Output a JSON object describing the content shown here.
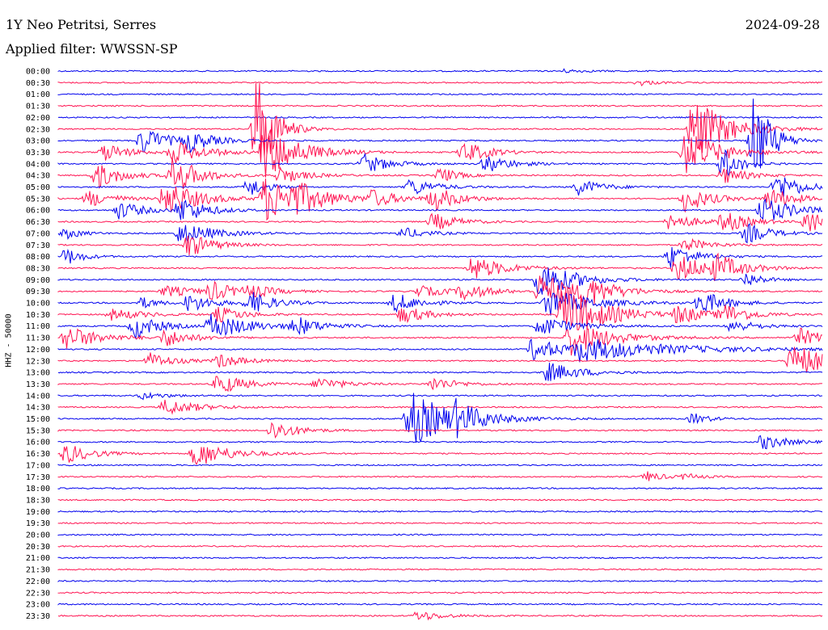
{
  "header": {
    "station": "1Y Neo Petritsi, Serres",
    "date": "2024-09-28",
    "filter": "Applied filter: WWSSN-SP",
    "channel": "HHZ - 50000"
  },
  "colors": {
    "even_row": "#0000ee",
    "odd_row": "#ff1452",
    "background": "#ffffff"
  },
  "chart_data": {
    "type": "line",
    "title": "1Y Neo Petritsi, Serres",
    "subtitle": "Applied filter: WWSSN-SP",
    "ylabel": "HHZ - 50000",
    "xlabel": "",
    "legend": "none",
    "grid": false,
    "rows": [
      "00:00",
      "00:30",
      "01:00",
      "01:30",
      "02:00",
      "02:30",
      "03:00",
      "03:30",
      "04:00",
      "04:30",
      "05:00",
      "05:30",
      "06:00",
      "06:30",
      "07:00",
      "07:30",
      "08:00",
      "08:30",
      "09:00",
      "09:30",
      "10:00",
      "10:30",
      "11:00",
      "11:30",
      "12:00",
      "12:30",
      "13:00",
      "13:30",
      "14:00",
      "14:30",
      "15:00",
      "15:30",
      "16:00",
      "16:30",
      "17:00",
      "17:30",
      "18:00",
      "18:30",
      "19:00",
      "19:30",
      "20:00",
      "20:30",
      "21:00",
      "21:30",
      "22:00",
      "22:30",
      "23:00",
      "23:30"
    ],
    "row_minutes": 30,
    "events": [
      {
        "row": 0,
        "t": 0.66,
        "amp": 0.3,
        "dur": 0.03
      },
      {
        "row": 1,
        "t": 0.76,
        "amp": 0.5,
        "dur": 0.02
      },
      {
        "row": 5,
        "t": 0.83,
        "amp": 6.0,
        "dur": 0.04
      },
      {
        "row": 5,
        "t": 0.26,
        "amp": 11.0,
        "dur": 0.02
      },
      {
        "row": 6,
        "t": 0.11,
        "amp": 2.5,
        "dur": 0.03
      },
      {
        "row": 6,
        "t": 0.17,
        "amp": 1.8,
        "dur": 0.03
      },
      {
        "row": 6,
        "t": 0.91,
        "amp": 9.0,
        "dur": 0.02
      },
      {
        "row": 7,
        "t": 0.06,
        "amp": 1.6,
        "dur": 0.03
      },
      {
        "row": 7,
        "t": 0.15,
        "amp": 2.0,
        "dur": 0.04
      },
      {
        "row": 7,
        "t": 0.27,
        "amp": 5.0,
        "dur": 0.04
      },
      {
        "row": 7,
        "t": 0.53,
        "amp": 2.0,
        "dur": 0.03
      },
      {
        "row": 7,
        "t": 0.82,
        "amp": 4.0,
        "dur": 0.04
      },
      {
        "row": 8,
        "t": 0.4,
        "amp": 1.8,
        "dur": 0.03
      },
      {
        "row": 8,
        "t": 0.56,
        "amp": 1.6,
        "dur": 0.03
      },
      {
        "row": 8,
        "t": 0.87,
        "amp": 3.0,
        "dur": 0.02
      },
      {
        "row": 9,
        "t": 0.05,
        "amp": 2.4,
        "dur": 0.03
      },
      {
        "row": 9,
        "t": 0.15,
        "amp": 3.6,
        "dur": 0.03
      },
      {
        "row": 9,
        "t": 0.29,
        "amp": 1.5,
        "dur": 0.03
      },
      {
        "row": 9,
        "t": 0.5,
        "amp": 1.5,
        "dur": 0.02
      },
      {
        "row": 9,
        "t": 0.87,
        "amp": 1.4,
        "dur": 0.03
      },
      {
        "row": 10,
        "t": 0.25,
        "amp": 1.8,
        "dur": 0.02
      },
      {
        "row": 10,
        "t": 0.46,
        "amp": 1.6,
        "dur": 0.03
      },
      {
        "row": 10,
        "t": 0.68,
        "amp": 1.4,
        "dur": 0.03
      },
      {
        "row": 10,
        "t": 0.94,
        "amp": 2.6,
        "dur": 0.03
      },
      {
        "row": 11,
        "t": 0.04,
        "amp": 1.5,
        "dur": 0.03
      },
      {
        "row": 11,
        "t": 0.14,
        "amp": 3.2,
        "dur": 0.04
      },
      {
        "row": 11,
        "t": 0.27,
        "amp": 4.0,
        "dur": 0.05
      },
      {
        "row": 11,
        "t": 0.31,
        "amp": 1.6,
        "dur": 0.03
      },
      {
        "row": 11,
        "t": 0.41,
        "amp": 1.4,
        "dur": 0.03
      },
      {
        "row": 11,
        "t": 0.49,
        "amp": 2.2,
        "dur": 0.03
      },
      {
        "row": 11,
        "t": 0.82,
        "amp": 2.4,
        "dur": 0.03
      },
      {
        "row": 11,
        "t": 0.93,
        "amp": 2.0,
        "dur": 0.03
      },
      {
        "row": 12,
        "t": 0.08,
        "amp": 1.6,
        "dur": 0.03
      },
      {
        "row": 12,
        "t": 0.16,
        "amp": 2.4,
        "dur": 0.03
      },
      {
        "row": 12,
        "t": 0.92,
        "amp": 2.4,
        "dur": 0.04
      },
      {
        "row": 13,
        "t": 0.49,
        "amp": 1.6,
        "dur": 0.03
      },
      {
        "row": 13,
        "t": 0.8,
        "amp": 1.6,
        "dur": 0.03
      },
      {
        "row": 13,
        "t": 0.87,
        "amp": 1.8,
        "dur": 0.03
      },
      {
        "row": 13,
        "t": 0.98,
        "amp": 2.4,
        "dur": 0.02
      },
      {
        "row": 14,
        "t": 0.01,
        "amp": 1.0,
        "dur": 0.02
      },
      {
        "row": 14,
        "t": 0.16,
        "amp": 2.0,
        "dur": 0.04
      },
      {
        "row": 14,
        "t": 0.45,
        "amp": 1.0,
        "dur": 0.03
      },
      {
        "row": 14,
        "t": 0.9,
        "amp": 1.8,
        "dur": 0.03
      },
      {
        "row": 15,
        "t": 0.17,
        "amp": 2.2,
        "dur": 0.03
      },
      {
        "row": 15,
        "t": 0.82,
        "amp": 1.2,
        "dur": 0.03
      },
      {
        "row": 16,
        "t": 0.01,
        "amp": 1.6,
        "dur": 0.02
      },
      {
        "row": 16,
        "t": 0.8,
        "amp": 2.2,
        "dur": 0.03
      },
      {
        "row": 17,
        "t": 0.54,
        "amp": 2.2,
        "dur": 0.04
      },
      {
        "row": 17,
        "t": 0.81,
        "amp": 2.4,
        "dur": 0.04
      },
      {
        "row": 17,
        "t": 0.86,
        "amp": 2.0,
        "dur": 0.03
      },
      {
        "row": 18,
        "t": 0.63,
        "amp": 3.6,
        "dur": 0.04
      },
      {
        "row": 18,
        "t": 0.9,
        "amp": 1.4,
        "dur": 0.02
      },
      {
        "row": 19,
        "t": 0.14,
        "amp": 1.0,
        "dur": 0.04
      },
      {
        "row": 19,
        "t": 0.2,
        "amp": 1.6,
        "dur": 0.03
      },
      {
        "row": 19,
        "t": 0.25,
        "amp": 1.0,
        "dur": 0.03
      },
      {
        "row": 19,
        "t": 0.47,
        "amp": 1.0,
        "dur": 0.04
      },
      {
        "row": 19,
        "t": 0.53,
        "amp": 1.4,
        "dur": 0.03
      },
      {
        "row": 19,
        "t": 0.63,
        "amp": 3.0,
        "dur": 0.05
      },
      {
        "row": 19,
        "t": 0.69,
        "amp": 2.2,
        "dur": 0.03
      },
      {
        "row": 20,
        "t": 0.11,
        "amp": 1.0,
        "dur": 0.02
      },
      {
        "row": 20,
        "t": 0.17,
        "amp": 1.6,
        "dur": 0.03
      },
      {
        "row": 20,
        "t": 0.25,
        "amp": 2.0,
        "dur": 0.03
      },
      {
        "row": 20,
        "t": 0.44,
        "amp": 1.8,
        "dur": 0.03
      },
      {
        "row": 20,
        "t": 0.64,
        "amp": 2.6,
        "dur": 0.05
      },
      {
        "row": 20,
        "t": 0.84,
        "amp": 2.2,
        "dur": 0.03
      },
      {
        "row": 21,
        "t": 0.07,
        "amp": 1.0,
        "dur": 0.04
      },
      {
        "row": 21,
        "t": 0.21,
        "amp": 1.4,
        "dur": 0.03
      },
      {
        "row": 21,
        "t": 0.45,
        "amp": 1.6,
        "dur": 0.03
      },
      {
        "row": 21,
        "t": 0.66,
        "amp": 5.0,
        "dur": 0.05
      },
      {
        "row": 21,
        "t": 0.81,
        "amp": 1.6,
        "dur": 0.03
      },
      {
        "row": 21,
        "t": 0.87,
        "amp": 1.8,
        "dur": 0.03
      },
      {
        "row": 22,
        "t": 0.1,
        "amp": 2.2,
        "dur": 0.03
      },
      {
        "row": 22,
        "t": 0.2,
        "amp": 2.2,
        "dur": 0.05
      },
      {
        "row": 22,
        "t": 0.31,
        "amp": 1.6,
        "dur": 0.03
      },
      {
        "row": 22,
        "t": 0.63,
        "amp": 1.8,
        "dur": 0.04
      },
      {
        "row": 22,
        "t": 0.88,
        "amp": 1.2,
        "dur": 0.03
      },
      {
        "row": 23,
        "t": 0.01,
        "amp": 2.2,
        "dur": 0.04
      },
      {
        "row": 23,
        "t": 0.14,
        "amp": 1.6,
        "dur": 0.03
      },
      {
        "row": 23,
        "t": 0.67,
        "amp": 3.0,
        "dur": 0.05
      },
      {
        "row": 23,
        "t": 0.97,
        "amp": 1.6,
        "dur": 0.03
      },
      {
        "row": 24,
        "t": 0.62,
        "amp": 2.0,
        "dur": 0.04
      },
      {
        "row": 24,
        "t": 0.68,
        "amp": 1.8,
        "dur": 0.12
      },
      {
        "row": 25,
        "t": 0.12,
        "amp": 1.4,
        "dur": 0.03
      },
      {
        "row": 25,
        "t": 0.21,
        "amp": 1.2,
        "dur": 0.03
      },
      {
        "row": 25,
        "t": 0.96,
        "amp": 2.8,
        "dur": 0.06
      },
      {
        "row": 26,
        "t": 0.64,
        "amp": 1.8,
        "dur": 0.04
      },
      {
        "row": 27,
        "t": 0.21,
        "amp": 2.0,
        "dur": 0.03
      },
      {
        "row": 27,
        "t": 0.34,
        "amp": 1.2,
        "dur": 0.03
      },
      {
        "row": 27,
        "t": 0.49,
        "amp": 1.2,
        "dur": 0.03
      },
      {
        "row": 28,
        "t": 0.11,
        "amp": 0.6,
        "dur": 0.03
      },
      {
        "row": 29,
        "t": 0.14,
        "amp": 1.4,
        "dur": 0.04
      },
      {
        "row": 30,
        "t": 0.46,
        "amp": 5.0,
        "dur": 0.05
      },
      {
        "row": 30,
        "t": 0.52,
        "amp": 2.0,
        "dur": 0.03
      },
      {
        "row": 30,
        "t": 0.83,
        "amp": 1.0,
        "dur": 0.02
      },
      {
        "row": 31,
        "t": 0.28,
        "amp": 1.8,
        "dur": 0.03
      },
      {
        "row": 32,
        "t": 0.92,
        "amp": 1.4,
        "dur": 0.03
      },
      {
        "row": 33,
        "t": 0.01,
        "amp": 1.8,
        "dur": 0.03
      },
      {
        "row": 33,
        "t": 0.18,
        "amp": 2.4,
        "dur": 0.04
      },
      {
        "row": 35,
        "t": 0.77,
        "amp": 0.9,
        "dur": 0.02
      },
      {
        "row": 35,
        "t": 0.82,
        "amp": 0.5,
        "dur": 0.02
      },
      {
        "row": 47,
        "t": 0.47,
        "amp": 0.9,
        "dur": 0.03
      }
    ]
  }
}
